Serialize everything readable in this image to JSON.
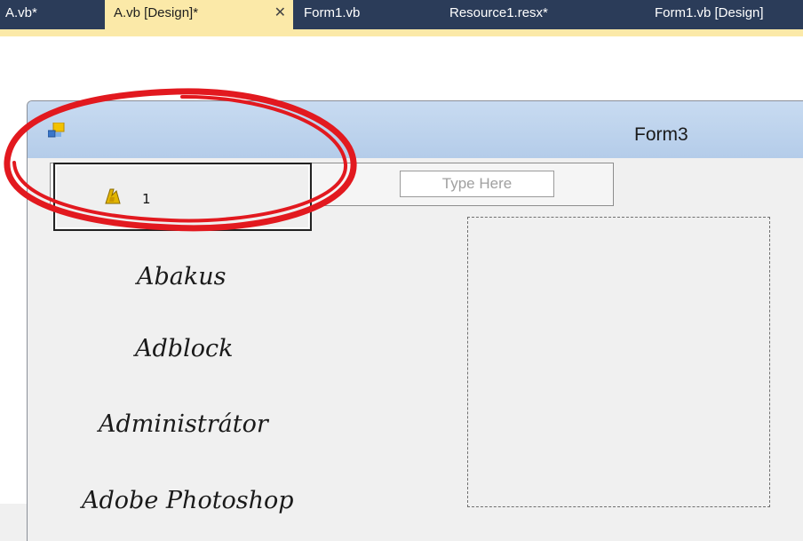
{
  "tabs": [
    {
      "label": "A.vb*",
      "active": false
    },
    {
      "label": "A.vb [Design]*",
      "active": true,
      "close": "✕"
    },
    {
      "label": "Form1.vb",
      "active": false
    },
    {
      "label": "Resource1.resx*",
      "active": false
    },
    {
      "label": "Form1.vb [Design]",
      "active": false
    }
  ],
  "form": {
    "title": "Form3",
    "icon": "form-icon",
    "menu_item": {
      "label": "1",
      "icon": "image-icon"
    },
    "type_here": "Type Here",
    "labels": [
      "Abakus",
      "Adblock",
      "Administrátor",
      "Adobe Photoshop"
    ]
  },
  "annotation": {
    "color": "#e2191f",
    "shape": "ellipse"
  },
  "colors": {
    "tab_bar": "#2b3c59",
    "active_tab": "#fbe9a8",
    "title_bar": "#bdd3ed"
  }
}
